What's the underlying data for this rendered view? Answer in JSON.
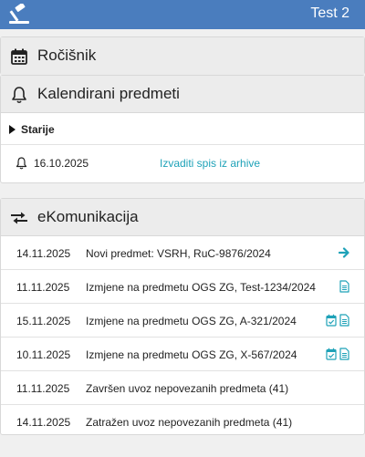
{
  "header": {
    "user_label": "Test 2",
    "brand_color": "#4a7dbe"
  },
  "rocisnik": {
    "title": "Ročišnik",
    "icon": "calendar-icon"
  },
  "kalendirani": {
    "title": "Kalendirani predmeti",
    "icon": "bell-icon",
    "older_label": "Starije",
    "items": [
      {
        "date": "16.10.2025",
        "action": "Izvaditi spis iz arhive"
      }
    ]
  },
  "ekomunikacija": {
    "title": "eKomunikacija",
    "icon": "exchange-icon",
    "accent_color": "#1fa2b8",
    "rows": [
      {
        "date": "14.11.2025",
        "text": "Novi predmet: VSRH, RuC-9876/2024",
        "icons": [
          "arrow-right-icon"
        ]
      },
      {
        "date": "11.11.2025",
        "text": "Izmjene na predmetu OGS ZG, Test-1234/2024",
        "icons": [
          "document-icon"
        ]
      },
      {
        "date": "15.11.2025",
        "text": "Izmjene na predmetu OGS ZG, A-321/2024",
        "icons": [
          "calendar-check-icon",
          "document-icon"
        ]
      },
      {
        "date": "10.11.2025",
        "text": "Izmjene na predmetu OGS ZG, X-567/2024",
        "icons": [
          "calendar-check-icon",
          "document-icon"
        ]
      },
      {
        "date": "11.11.2025",
        "text": "Završen uvoz nepovezanih predmeta (41)",
        "icons": []
      },
      {
        "date": "14.11.2025",
        "text": "Zatražen uvoz nepovezanih predmeta (41)",
        "icons": []
      }
    ]
  }
}
